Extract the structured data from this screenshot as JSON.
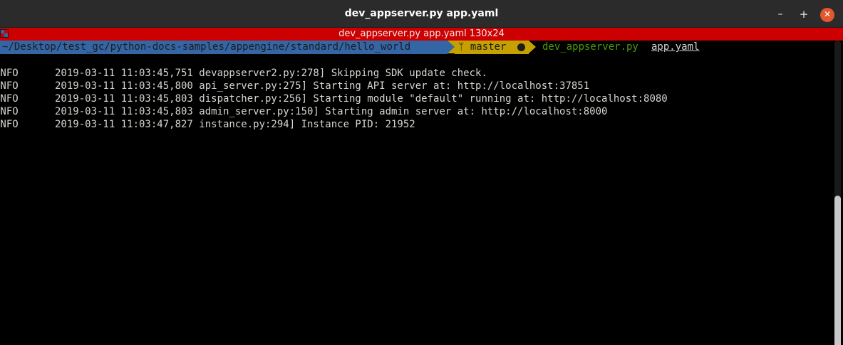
{
  "window": {
    "title": "dev_appserver.py app.yaml",
    "buttons": {
      "minimize": "–",
      "maximize": "+",
      "close": "✕"
    }
  },
  "status_bar": {
    "title": "dev_appserver.py app.yaml 130x24",
    "color": "#cc0000"
  },
  "prompt": {
    "path": "~/Desktop/test_gc/python-docs-samples/appengine/standard/hello_world",
    "branch_icon": "ᛘ",
    "branch": " master",
    "command": "dev_appserver.py",
    "argument": "app.yaml",
    "colors": {
      "path_bg": "#3465a4",
      "branch_bg": "#c4a000",
      "command": "#4e9a06"
    }
  },
  "log": [
    {
      "level": "INFO",
      "text": "2019-03-11 11:03:45,751 devappserver2.py:278] Skipping SDK update check."
    },
    {
      "level": "INFO",
      "text": "2019-03-11 11:03:45,800 api_server.py:275] Starting API server at: http://localhost:37851"
    },
    {
      "level": "INFO",
      "text": "2019-03-11 11:03:45,803 dispatcher.py:256] Starting module \"default\" running at: http://localhost:8080"
    },
    {
      "level": "INFO",
      "text": "2019-03-11 11:03:45,803 admin_server.py:150] Starting admin server at: http://localhost:8000"
    },
    {
      "level": "INFO",
      "text": "2019-03-11 11:03:47,827 instance.py:294] Instance PID: 21952"
    }
  ]
}
